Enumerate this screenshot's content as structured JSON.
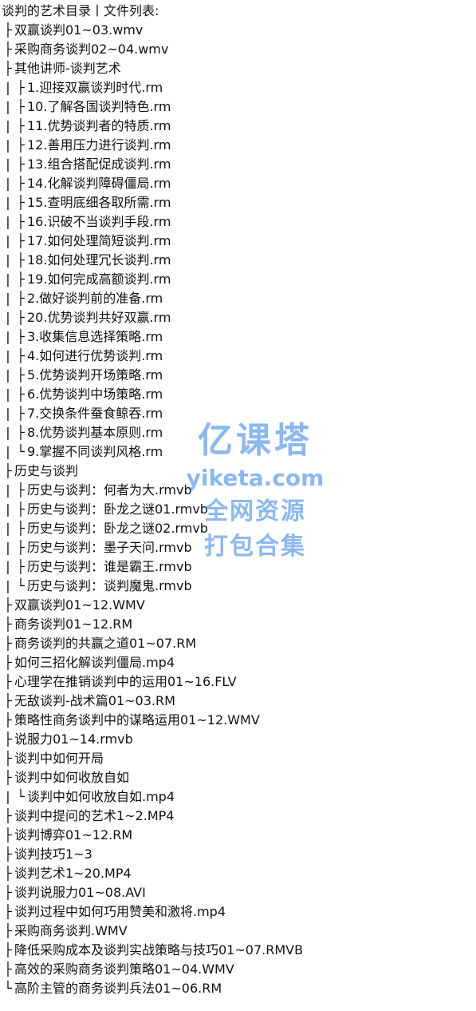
{
  "title": "谈判的艺术目录丨文件列表:",
  "tree": [
    {
      "depth": 0,
      "last": false,
      "text": "双赢谈判01~03.wmv"
    },
    {
      "depth": 0,
      "last": false,
      "text": "采购商务谈判02~04.wmv"
    },
    {
      "depth": 0,
      "last": false,
      "text": "其他讲师-谈判艺术"
    },
    {
      "depth": 1,
      "last": false,
      "text": "1.迎接双赢谈判时代.rm"
    },
    {
      "depth": 1,
      "last": false,
      "text": "10.了解各国谈判特色.rm"
    },
    {
      "depth": 1,
      "last": false,
      "text": "11.优势谈判者的特质.rm"
    },
    {
      "depth": 1,
      "last": false,
      "text": "12.善用压力进行谈判.rm"
    },
    {
      "depth": 1,
      "last": false,
      "text": "13.组合搭配促成谈判.rm"
    },
    {
      "depth": 1,
      "last": false,
      "text": "14.化解谈判障碍僵局.rm"
    },
    {
      "depth": 1,
      "last": false,
      "text": "15.查明底细各取所需.rm"
    },
    {
      "depth": 1,
      "last": false,
      "text": "16.识破不当谈判手段.rm"
    },
    {
      "depth": 1,
      "last": false,
      "text": "17.如何处理简短谈判.rm"
    },
    {
      "depth": 1,
      "last": false,
      "text": "18.如何处理冗长谈判.rm"
    },
    {
      "depth": 1,
      "last": false,
      "text": "19.如何完成高额谈判.rm"
    },
    {
      "depth": 1,
      "last": false,
      "text": "2.做好谈判前的准备.rm"
    },
    {
      "depth": 1,
      "last": false,
      "text": "20.优势谈判共好双赢.rm"
    },
    {
      "depth": 1,
      "last": false,
      "text": "3.收集信息选择策略.rm"
    },
    {
      "depth": 1,
      "last": false,
      "text": "4.如何进行优势谈判.rm"
    },
    {
      "depth": 1,
      "last": false,
      "text": "5.优势谈判开场策略.rm"
    },
    {
      "depth": 1,
      "last": false,
      "text": "6.优势谈判中场策略.rm"
    },
    {
      "depth": 1,
      "last": false,
      "text": "7.交换条件蚕食鲸吞.rm"
    },
    {
      "depth": 1,
      "last": false,
      "text": "8.优势谈判基本原则.rm"
    },
    {
      "depth": 1,
      "last": true,
      "text": "9.掌握不同谈判风格.rm"
    },
    {
      "depth": 0,
      "last": false,
      "text": "历史与谈判"
    },
    {
      "depth": 1,
      "last": false,
      "text": "历史与谈判：何者为大.rmvb"
    },
    {
      "depth": 1,
      "last": false,
      "text": "历史与谈判：卧龙之谜01.rmvb"
    },
    {
      "depth": 1,
      "last": false,
      "text": "历史与谈判：卧龙之谜02.rmvb"
    },
    {
      "depth": 1,
      "last": false,
      "text": "历史与谈判：墨子天问.rmvb"
    },
    {
      "depth": 1,
      "last": false,
      "text": "历史与谈判：谁是霸王.rmvb"
    },
    {
      "depth": 1,
      "last": true,
      "text": "历史与谈判：谈判魔鬼.rmvb"
    },
    {
      "depth": 0,
      "last": false,
      "text": "双赢谈判01~12.WMV"
    },
    {
      "depth": 0,
      "last": false,
      "text": "商务谈判01~12.RM"
    },
    {
      "depth": 0,
      "last": false,
      "text": "商务谈判的共赢之道01~07.RM"
    },
    {
      "depth": 0,
      "last": false,
      "text": "如何三招化解谈判僵局.mp4"
    },
    {
      "depth": 0,
      "last": false,
      "text": "心理学在推销谈判中的运用01~16.FLV"
    },
    {
      "depth": 0,
      "last": false,
      "text": "无敌谈判-战术篇01~03.RM"
    },
    {
      "depth": 0,
      "last": false,
      "text": "策略性商务谈判中的谋略运用01~12.WMV"
    },
    {
      "depth": 0,
      "last": false,
      "text": "说服力01~14.rmvb"
    },
    {
      "depth": 0,
      "last": false,
      "text": "谈判中如何开局"
    },
    {
      "depth": 0,
      "last": false,
      "text": "谈判中如何收放自如"
    },
    {
      "depth": 1,
      "last": true,
      "text": "谈判中如何收放自如.mp4"
    },
    {
      "depth": 0,
      "last": false,
      "text": "谈判中提问的艺术1~2.MP4"
    },
    {
      "depth": 0,
      "last": false,
      "text": "谈判博弈01~12.RM"
    },
    {
      "depth": 0,
      "last": false,
      "text": "谈判技巧1~3"
    },
    {
      "depth": 0,
      "last": false,
      "text": "谈判艺术1~20.MP4"
    },
    {
      "depth": 0,
      "last": false,
      "text": "谈判说服力01~08.AVI"
    },
    {
      "depth": 0,
      "last": false,
      "text": "谈判过程中如何巧用赞美和激将.mp4"
    },
    {
      "depth": 0,
      "last": false,
      "text": "采购商务谈判.WMV"
    },
    {
      "depth": 0,
      "last": false,
      "text": "降低采购成本及谈判实战策略与技巧01~07.RMVB"
    },
    {
      "depth": 0,
      "last": false,
      "text": "高效的采购商务谈判策略01~04.WMV"
    },
    {
      "depth": 0,
      "last": true,
      "text": "高阶主管的商务谈判兵法01~06.RM"
    }
  ],
  "watermark": {
    "logo": "亿课塔",
    "site": "yiketa.com",
    "line1": "全网资源",
    "line2": "打包合集",
    "color": "#2f7fe0"
  }
}
